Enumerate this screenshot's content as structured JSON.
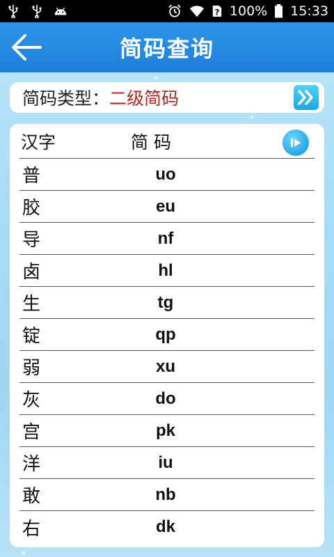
{
  "status_bar": {
    "battery_text": "100%",
    "time": "15:33",
    "icons": [
      "usb-icon",
      "usb-icon",
      "android-icon",
      "alarm-icon",
      "wifi-icon",
      "sim-unknown-icon",
      "battery-icon"
    ]
  },
  "header": {
    "title": "简码查询",
    "back_icon": "arrow-left-icon"
  },
  "type_selector": {
    "label": "简码类型：",
    "value": "二级简码",
    "next_icon": "double-chevron-right-icon"
  },
  "table": {
    "col_char": "汉字",
    "col_code": "简码",
    "play_icon": "play-icon",
    "rows": [
      {
        "char": "普",
        "code": "uo"
      },
      {
        "char": "胶",
        "code": "eu"
      },
      {
        "char": "导",
        "code": "nf"
      },
      {
        "char": "卤",
        "code": "hl"
      },
      {
        "char": "生",
        "code": "tg"
      },
      {
        "char": "锭",
        "code": "qp"
      },
      {
        "char": "弱",
        "code": "xu"
      },
      {
        "char": "灰",
        "code": "do"
      },
      {
        "char": "宫",
        "code": "pk"
      },
      {
        "char": "洋",
        "code": "iu"
      },
      {
        "char": "敢",
        "code": "nb"
      },
      {
        "char": "右",
        "code": "dk"
      }
    ]
  },
  "colors": {
    "header_blue": "#1f7fd9",
    "accent_red": "#b0261e",
    "button_cyan": "#1aa7e4"
  }
}
